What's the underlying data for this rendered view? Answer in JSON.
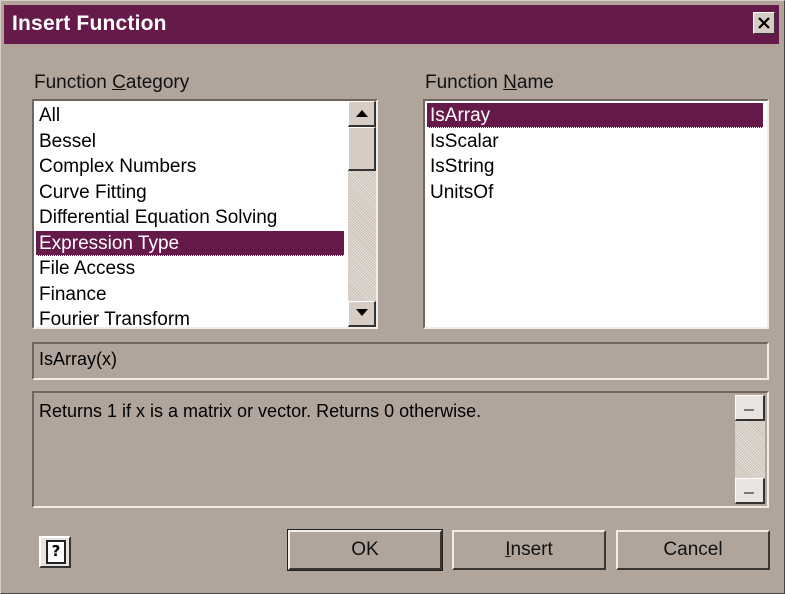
{
  "dialog": {
    "title": "Insert Function",
    "close_label": "Close"
  },
  "category": {
    "label_pre": "Function ",
    "label_accel": "C",
    "label_post": "ategory",
    "items": [
      "All",
      "Bessel",
      "Complex Numbers",
      "Curve Fitting",
      "Differential Equation Solving",
      "Expression Type",
      "File Access",
      "Finance",
      "Fourier Transform"
    ],
    "selected": "Expression Type"
  },
  "name": {
    "label_pre": "Function ",
    "label_accel": "N",
    "label_post": "ame",
    "items": [
      "IsArray",
      "IsScalar",
      "IsString",
      "UnitsOf"
    ],
    "selected": "IsArray"
  },
  "signature": "IsArray(x)",
  "description": "Returns 1 if x is a matrix or vector. Returns 0 otherwise.",
  "buttons": {
    "help_icon": "help-icon",
    "ok": "OK",
    "insert_accel": "I",
    "insert_rest": "nsert",
    "cancel": "Cancel"
  },
  "colors": {
    "titlebar": "#661a4a",
    "selection": "#661a4a",
    "face": "#b0a49b"
  }
}
